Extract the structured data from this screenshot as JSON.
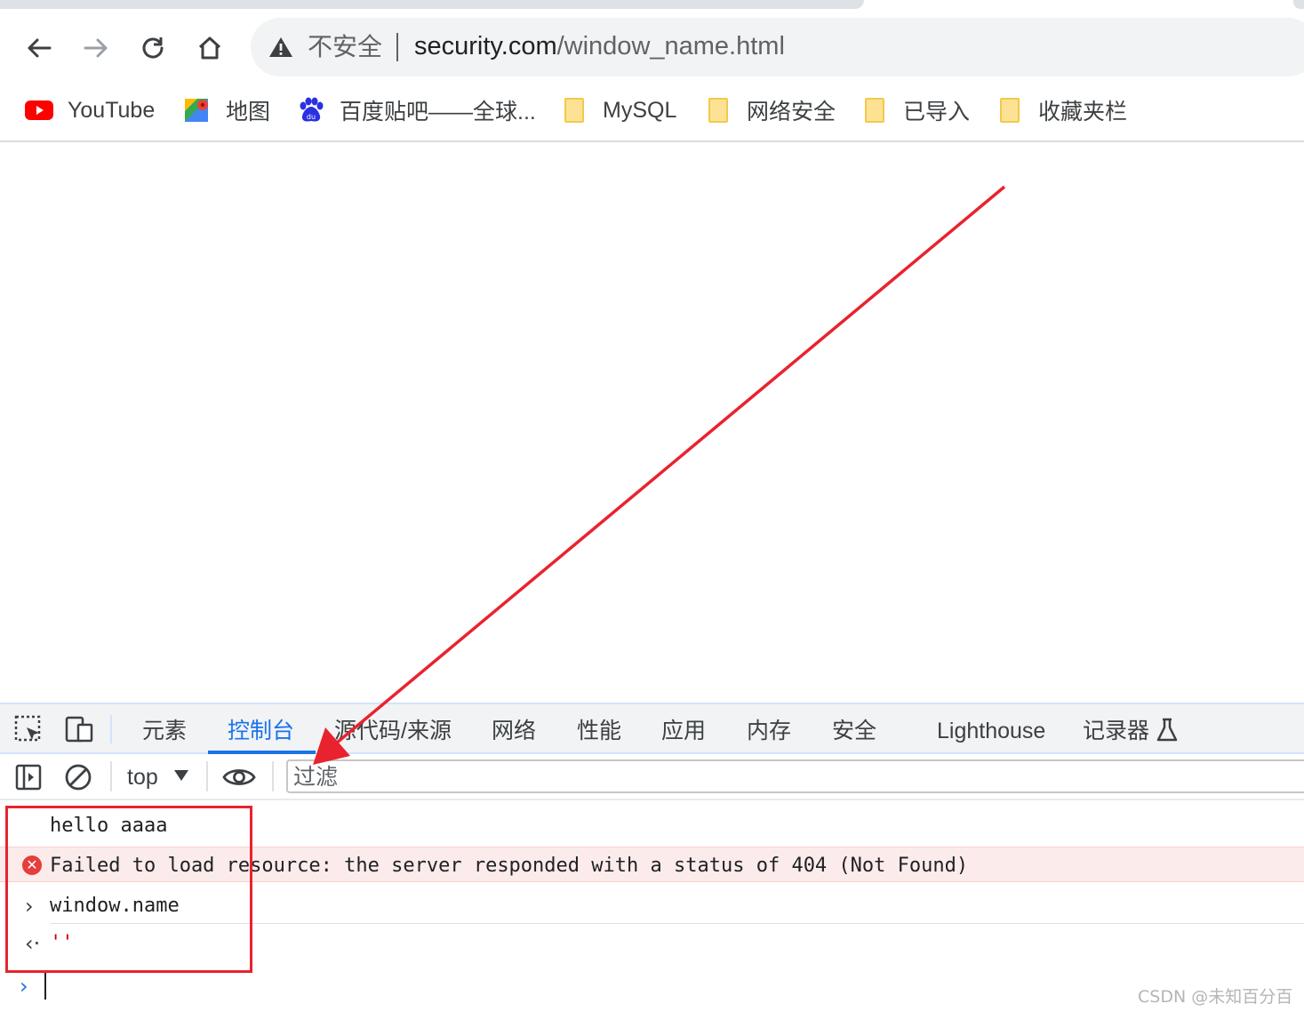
{
  "browser": {
    "security_label": "不安全",
    "url_host": "security.com",
    "url_path": "/window_name.html"
  },
  "bookmarks": [
    {
      "label": "YouTube",
      "icon": "youtube-icon"
    },
    {
      "label": "地图",
      "icon": "maps-icon"
    },
    {
      "label": "百度贴吧——全球...",
      "icon": "baidu-icon"
    },
    {
      "label": "MySQL",
      "icon": "folder-icon"
    },
    {
      "label": "网络安全",
      "icon": "folder-icon"
    },
    {
      "label": "已导入",
      "icon": "folder-icon"
    },
    {
      "label": "收藏夹栏",
      "icon": "folder-icon"
    }
  ],
  "devtools": {
    "tabs": [
      {
        "label": "元素"
      },
      {
        "label": "控制台"
      },
      {
        "label": "源代码/来源"
      },
      {
        "label": "网络"
      },
      {
        "label": "性能"
      },
      {
        "label": "应用"
      },
      {
        "label": "内存"
      },
      {
        "label": "安全"
      },
      {
        "label": "Lighthouse"
      },
      {
        "label": "记录器"
      }
    ],
    "active_tab": "控制台",
    "context": "top",
    "filter_placeholder": "过滤"
  },
  "console": {
    "log": "hello aaaa",
    "error": "Failed to load resource: the server responded with a status of 404 (Not Found)",
    "input": "window.name",
    "result": "''"
  },
  "colors": {
    "accent": "#1a73e8",
    "error_bg": "#fcebeb",
    "annotation": "#e8232f"
  },
  "watermark": "CSDN @未知百分百"
}
